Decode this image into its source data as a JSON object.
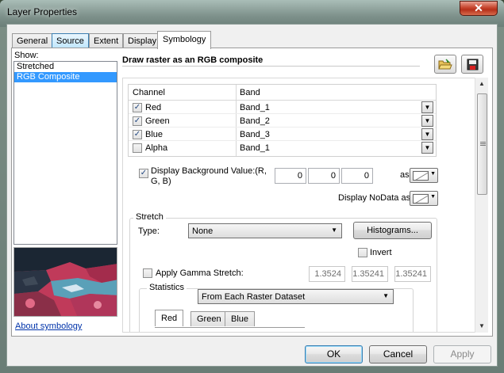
{
  "window": {
    "title": "Layer Properties",
    "close_glyph": "✕"
  },
  "tabs": [
    "General",
    "Source",
    "Extent",
    "Display",
    "Symbology"
  ],
  "show": {
    "label": "Show:",
    "items": [
      "Stretched",
      "RGB Composite"
    ],
    "selected": "RGB Composite",
    "about_link": "About symbology"
  },
  "symbology": {
    "title": "Draw raster as an RGB composite",
    "buttons": {
      "open_icon": "folder-open-icon",
      "save_icon": "save-disk-icon"
    },
    "grid": {
      "headers": [
        "Channel",
        "Band"
      ],
      "rows": [
        {
          "channel": "Red",
          "band": "Band_1",
          "checked": true
        },
        {
          "channel": "Green",
          "band": "Band_2",
          "checked": true
        },
        {
          "channel": "Blue",
          "band": "Band_3",
          "checked": true
        },
        {
          "channel": "Alpha",
          "band": "Band_1",
          "checked": false
        }
      ]
    },
    "background": {
      "label_line1": "Display Background Value:(R,",
      "label_line2": "G, B)",
      "checked": true,
      "values": [
        "0",
        "0",
        "0"
      ],
      "as_label": "as"
    },
    "nodata": {
      "label": "Display NoData as"
    },
    "stretch": {
      "group_label": "Stretch",
      "type_label": "Type:",
      "type_value": "None",
      "histograms_button": "Histograms...",
      "invert_label": "Invert",
      "invert_checked": false,
      "gamma_label": "Apply Gamma Stretch:",
      "gamma_checked": false,
      "gamma_values": [
        "1.3524",
        "1.35241",
        "1.35241"
      ]
    },
    "statistics": {
      "group_label": "Statistics",
      "value": "From Each Raster Dataset",
      "subtabs": [
        "Red",
        "Green",
        "Blue"
      ]
    }
  },
  "footer": {
    "ok": "OK",
    "cancel": "Cancel",
    "apply": "Apply"
  }
}
